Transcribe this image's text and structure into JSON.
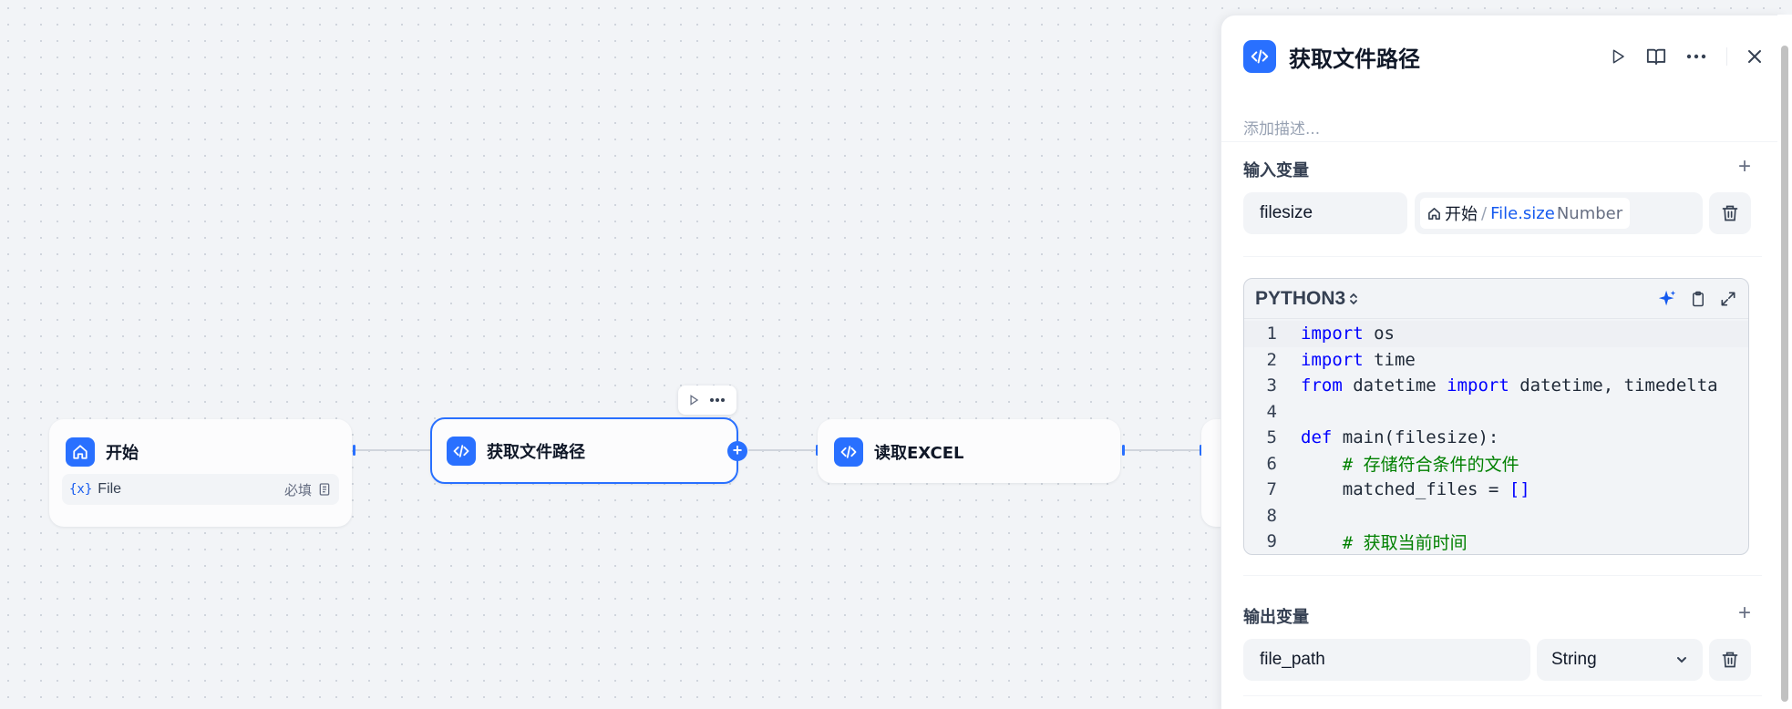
{
  "nodes": {
    "start": {
      "title": "开始",
      "var_icon": "{x}",
      "var_name": "File",
      "required": "必填"
    },
    "get_path": {
      "title": "获取文件路径"
    },
    "read_excel": {
      "title": "读取EXCEL"
    }
  },
  "panel": {
    "title": "获取文件路径",
    "description_placeholder": "添加描述...",
    "input_section": {
      "title": "输入变量",
      "add": "+",
      "variable_name": "filesize",
      "ref_node": "开始",
      "ref_sep": "/",
      "ref_path": "File.size",
      "ref_type": "Number"
    },
    "code": {
      "language": "PYTHON3",
      "lines": [
        {
          "n": "1",
          "segments": [
            {
              "t": "import",
              "c": "kw"
            },
            {
              "t": " os",
              "c": "code-text"
            }
          ]
        },
        {
          "n": "2",
          "segments": [
            {
              "t": "import",
              "c": "kw"
            },
            {
              "t": " time",
              "c": "code-text"
            }
          ]
        },
        {
          "n": "3",
          "segments": [
            {
              "t": "from",
              "c": "kw"
            },
            {
              "t": " datetime ",
              "c": "code-text"
            },
            {
              "t": "import",
              "c": "kw"
            },
            {
              "t": " datetime, timedelta",
              "c": "code-text"
            }
          ]
        },
        {
          "n": "4",
          "segments": []
        },
        {
          "n": "5",
          "segments": [
            {
              "t": "def",
              "c": "kw"
            },
            {
              "t": " main(filesize):",
              "c": "code-text"
            }
          ]
        },
        {
          "n": "6",
          "segments": [
            {
              "t": "    # 存储符合条件的文件",
              "c": "cm"
            }
          ]
        },
        {
          "n": "7",
          "segments": [
            {
              "t": "    matched_files = ",
              "c": "code-text"
            },
            {
              "t": "[]",
              "c": "kw"
            }
          ]
        },
        {
          "n": "8",
          "segments": []
        },
        {
          "n": "9",
          "segments": [
            {
              "t": "    # 获取当前时间",
              "c": "cm"
            }
          ]
        }
      ]
    },
    "output_section": {
      "title": "输出变量",
      "add": "+",
      "variable_name": "file_path",
      "type": "String"
    }
  },
  "colors": {
    "accent": "#2970ff",
    "keyword": "#0000ff",
    "comment": "#008000"
  }
}
